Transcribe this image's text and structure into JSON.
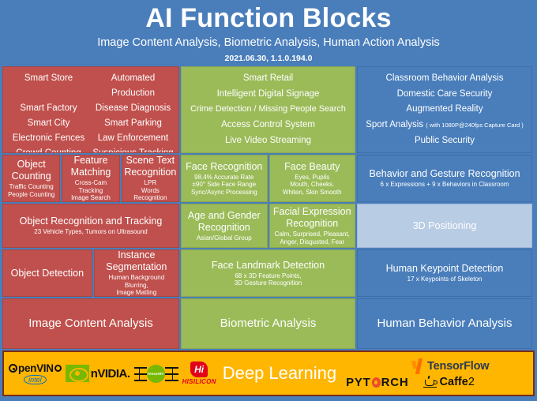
{
  "header": {
    "title": "AI Function Blocks",
    "subtitle": "Image Content Analysis, Biometric Analysis, Human Action Analysis",
    "version": "2021.06.30, 1.1.0.194.0"
  },
  "colors": {
    "red": "#c0504d",
    "green": "#9bbb59",
    "blue": "#4a7ebb",
    "light_blue": "#b8cce4",
    "header_bg": "#4a7ebb",
    "deep_learning_bg": "#ffb600",
    "deep_learning_border": "#7b2d14"
  },
  "columns": {
    "red": {
      "applications": {
        "rows": [
          [
            "Smart Store",
            "Automated Production"
          ],
          [
            "Smart Factory",
            "Disease Diagnosis"
          ],
          [
            "Smart City",
            "Smart Parking"
          ],
          [
            "Electronic Fences",
            "Law Enforcement"
          ],
          [
            "Crowd Counting",
            "Suspicious Tracking"
          ]
        ]
      },
      "features_row2": [
        {
          "title": "Object Counting",
          "sub": "Traffic Counting\nPeople Counting"
        },
        {
          "title": "Feature Matching",
          "sub": "Cross-Cam Tracking\nImage Search"
        },
        {
          "title": "Scene Text Recognition",
          "sub": "LPR\nWords Recognition"
        }
      ],
      "features_row3": [
        {
          "title": "Object Recognition and Tracking",
          "sub": "23 Vehicle Types, Tumors on Ultrasound"
        }
      ],
      "features_row4": [
        {
          "title": "Object Detection",
          "sub": ""
        },
        {
          "title": "Instance Segmentation",
          "sub": "Human Background Blurring,\nImage Matting"
        }
      ],
      "summary": "Image Content Analysis"
    },
    "green": {
      "applications": {
        "lines": [
          "Smart Retail",
          "Intelligent Digital Signage",
          "Crime Detection / Missing People Search",
          "Access Control System",
          "Live Video Streaming"
        ]
      },
      "features_row2": [
        {
          "title": "Face Recognition",
          "sub": "98.4% Accurate Rate\n±90° Side Face Range\nSync/Async Processing"
        },
        {
          "title": "Face Beauty",
          "sub": "Eyes, Pupils\nMouth, Cheeks.\nWhiten, Skin Smooth"
        }
      ],
      "features_row3": [
        {
          "title": "Age and Gender Recognition",
          "sub": "Asian/Global Group"
        },
        {
          "title": "Facial Expression Recognition",
          "sub": "Calm, Surprised, Pleasant,\nAnger, Disgusted, Fear"
        }
      ],
      "features_row4": [
        {
          "title": "Face Landmark Detection",
          "sub": "68 x 3D Feature Points,\n3D Gesture Recognition"
        }
      ],
      "summary": "Biometric Analysis"
    },
    "blue": {
      "applications": {
        "lines": [
          {
            "text": "Classroom Behavior Analysis",
            "note": ""
          },
          {
            "text": "Domestic Care Security",
            "note": ""
          },
          {
            "text": "Augmented Reality",
            "note": ""
          },
          {
            "text": "Sport Analysis",
            "note": "( with 1080P@240fps Capture Card )"
          },
          {
            "text": "Public Security",
            "note": ""
          }
        ]
      },
      "features_row2": [
        {
          "title": "Behavior and Gesture Recognition",
          "sub": "6 x Expressions + 9 x Behaviors in Classroom"
        }
      ],
      "features_row3": [
        {
          "title": "3D Positioning",
          "sub": ""
        }
      ],
      "features_row4": [
        {
          "title": "Human Keypoint Detection",
          "sub": "17 x Keypoints of Skeleton"
        }
      ],
      "summary": "Human Behavior Analysis"
    }
  },
  "deep_learning": {
    "title": "Deep Learning",
    "logos": [
      {
        "name": "openvino-logo",
        "text": "penVIN",
        "sub": "intel"
      },
      {
        "name": "nvidia-logo",
        "text": "nVIDIA."
      },
      {
        "name": "tensorrt-logo",
        "text": "TensorRT"
      },
      {
        "name": "hisilicon-logo",
        "text": "HISILICON",
        "mark": "Hi"
      },
      {
        "name": "tensorflow-logo",
        "text": "TensorFlow"
      },
      {
        "name": "pytorch-logo",
        "text_a": "PYT",
        "text_b": "RCH"
      },
      {
        "name": "caffe2-logo",
        "text": "Caffe",
        "suffix": "2"
      }
    ]
  }
}
